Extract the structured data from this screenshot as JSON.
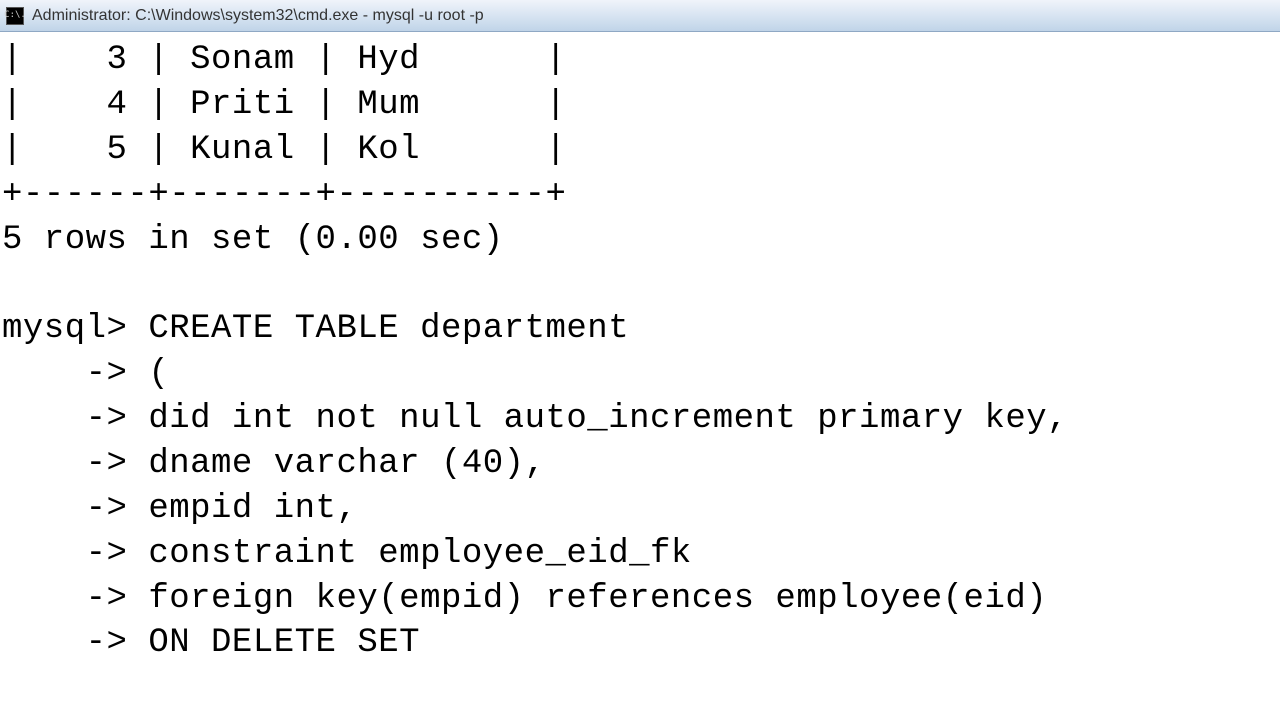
{
  "titlebar": {
    "icon_text": "C:\\.",
    "text": "Administrator: C:\\Windows\\system32\\cmd.exe - mysql  -u root -p"
  },
  "terminal": {
    "lines": [
      "|    3 | Sonam | Hyd      |",
      "|    4 | Priti | Mum      |",
      "|    5 | Kunal | Kol      |",
      "+------+-------+----------+",
      "5 rows in set (0.00 sec)",
      "",
      "mysql> CREATE TABLE department",
      "    -> (",
      "    -> did int not null auto_increment primary key,",
      "    -> dname varchar (40),",
      "    -> empid int,",
      "    -> constraint employee_eid_fk",
      "    -> foreign key(empid) references employee(eid)",
      "    -> ON DELETE SET"
    ]
  }
}
